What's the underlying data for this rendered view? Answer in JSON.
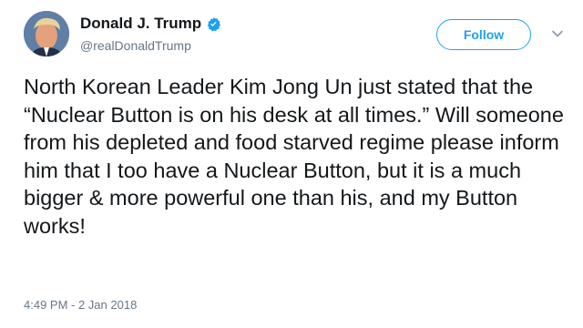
{
  "author": {
    "display_name": "Donald J. Trump",
    "handle": "@realDonaldTrump",
    "verified": true,
    "avatar_icon": "profile-photo"
  },
  "actions": {
    "follow_label": "Follow",
    "menu_icon": "chevron-down-icon"
  },
  "tweet": {
    "text": "North Korean Leader Kim Jong Un just stated that the “Nuclear Button is on his desk at all times.” Will someone from his depleted and food starved regime please inform him that I too have a Nuclear Button, but it is a much bigger & more powerful one than his, and my Button works!",
    "timestamp": "4:49 PM - 2 Jan 2018"
  },
  "colors": {
    "accent": "#1da1f2",
    "text": "#14171a",
    "secondary_text": "#657786"
  }
}
